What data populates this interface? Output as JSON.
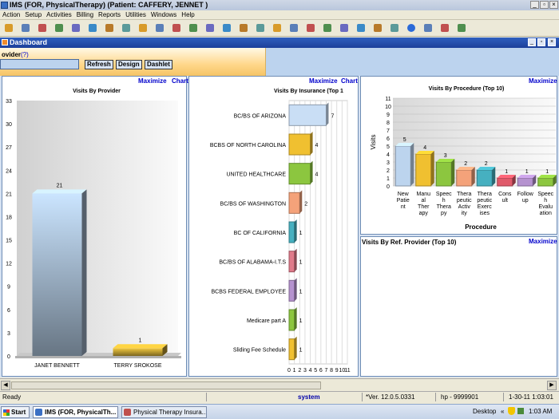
{
  "window": {
    "title": "IMS (FOR, PhysicalTherapy)     (Patient: CAFFERY, JENNET )"
  },
  "menu": [
    "Action",
    "Setup",
    "Activities",
    "Billing",
    "Reports",
    "Utilities",
    "Windows",
    "Help"
  ],
  "toolbar_icons": [
    "patient-icon",
    "lock-icon",
    "calendar-icon",
    "notes-icon",
    "chart-icon",
    "claims-icon",
    "payments-icon",
    "statements-icon",
    "reports-icon",
    "ledger-icon",
    "card-icon",
    "letter-icon",
    "search-icon",
    "edit-icon",
    "recall-icon",
    "group-icon",
    "schedule-icon",
    "forms-icon",
    "stats-icon",
    "tasks-icon",
    "document-icon",
    "fax-icon",
    "word-icon",
    "email-icon",
    "help-icon",
    "key-icon",
    "secure-icon",
    "exit-icon"
  ],
  "dashboard": {
    "title": "Dashboard",
    "provider_label": "ovider",
    "help_marker": "(?)",
    "buttons": {
      "refresh": "Refresh",
      "design": "Design",
      "dashlet": "Dashlet"
    }
  },
  "panels": {
    "maximize": "Maximize",
    "chart_link": "Chart",
    "ref_provider_title": "Visits By Ref. Provider (Top 10)"
  },
  "chart_data": [
    {
      "type": "bar",
      "title": "Visits By Provider",
      "categories": [
        "JANET BENNETT",
        "TERRY SROKOSE"
      ],
      "values": [
        21,
        1
      ],
      "ylim": [
        0,
        33
      ],
      "yticks": [
        0,
        3,
        6,
        9,
        12,
        15,
        18,
        21,
        24,
        27,
        30,
        33
      ],
      "colors": [
        "#bcd4ee",
        "#e0b93a"
      ]
    },
    {
      "type": "bar",
      "orientation": "horizontal",
      "title": "Visits By Insurance  (Top 1",
      "categories": [
        "BC/BS OF ARIZONA",
        "BCBS OF NORTH CAROLINA",
        "UNITED HEALTHCARE",
        "BC/BS OF WASHINGTON",
        "BC OF CALIFORNIA",
        "BC/BS OF ALABAMA-I.T.S",
        "BCBS FEDERAL EMPLOYEE",
        "Medicare part A",
        "Sliding Fee Schedule"
      ],
      "values": [
        7,
        4,
        4,
        2,
        1,
        1,
        1,
        1,
        1
      ],
      "xlim": [
        0,
        11
      ],
      "xticks": [
        "0",
        "1",
        "2",
        "3",
        "4",
        "5",
        "6",
        "7",
        "8",
        "9",
        "10",
        "11"
      ],
      "colors": [
        "#c9def5",
        "#f0c030",
        "#8cc63f",
        "#f4a27a",
        "#46b0c0",
        "#e07a8a",
        "#b592cf",
        "#8cc63f",
        "#f0c030"
      ]
    },
    {
      "type": "bar",
      "title": "Visits By Procedure  (Top 10)",
      "xlabel": "Procedure",
      "ylabel": "Visits",
      "categories": [
        [
          "New",
          "Patie",
          "nt"
        ],
        [
          "Manu",
          "al",
          "Ther",
          "apy"
        ],
        [
          "Speec",
          "h",
          "Thera",
          "py"
        ],
        [
          "Thera",
          "peutic",
          "Activ",
          "ity"
        ],
        [
          "Thera",
          "peutic",
          "Exerc",
          "ises"
        ],
        [
          "Cons",
          "ult"
        ],
        [
          "Follow",
          "up"
        ],
        [
          "Speec",
          "h",
          "Evalu",
          "ation"
        ]
      ],
      "values": [
        5,
        4,
        3,
        2,
        2,
        1,
        1,
        1
      ],
      "ylim": [
        0,
        11
      ],
      "yticks": [
        0,
        1,
        2,
        3,
        4,
        5,
        6,
        7,
        8,
        9,
        10,
        11
      ],
      "colors": [
        "#bcd4ee",
        "#f0c030",
        "#8cc63f",
        "#f4a27a",
        "#46b0c0",
        "#e05a6a",
        "#b592cf",
        "#8cc63f"
      ]
    }
  ],
  "status": {
    "ready": "Ready",
    "user": "system",
    "version": "*Ver. 12.0.5.0331",
    "host": "hp - 9999901",
    "datetime": "1-30-11 1:03:01"
  },
  "taskbar": {
    "start": "Start",
    "tasks": [
      "IMS (FOR, PhysicalTh...",
      "Physical Therapy Insura..."
    ],
    "desktop": "Desktop",
    "chevrons": "«",
    "clock": "1:03 AM"
  }
}
